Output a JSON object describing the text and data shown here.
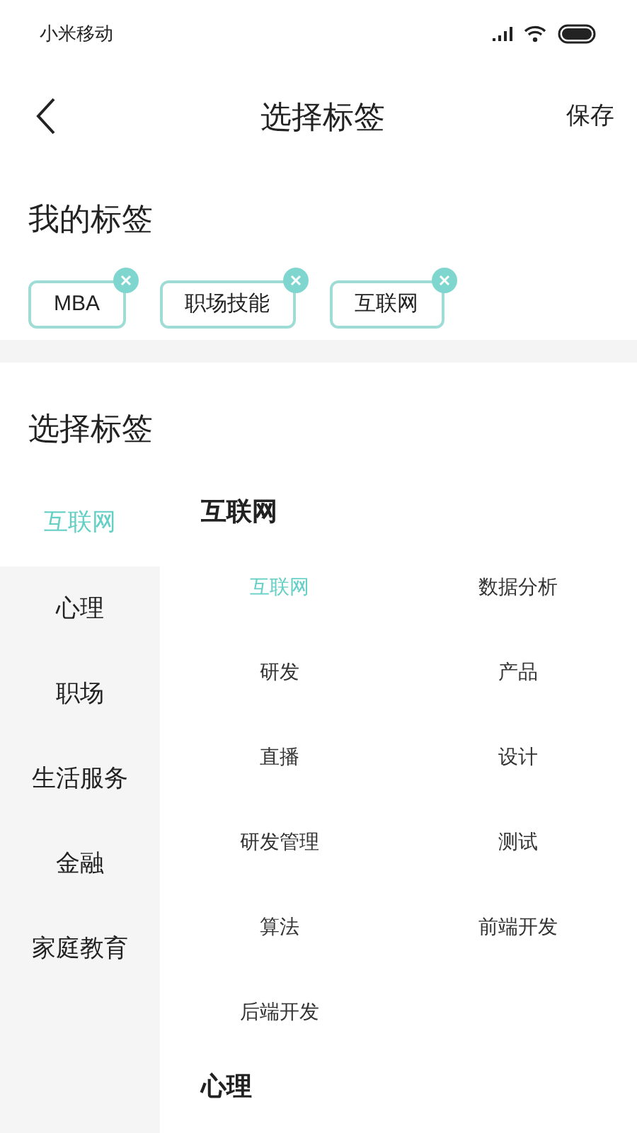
{
  "status_bar": {
    "carrier": "小米移动"
  },
  "nav": {
    "title": "选择标签",
    "action": "保存"
  },
  "my_tags": {
    "title": "我的标签",
    "tags": [
      {
        "label": "MBA"
      },
      {
        "label": "职场技能"
      },
      {
        "label": "互联网"
      }
    ]
  },
  "choose": {
    "title": "选择标签"
  },
  "sidebar": {
    "items": [
      {
        "label": "互联网",
        "selected": true
      },
      {
        "label": "心理",
        "selected": false
      },
      {
        "label": "职场",
        "selected": false
      },
      {
        "label": "生活服务",
        "selected": false
      },
      {
        "label": "金融",
        "selected": false
      },
      {
        "label": "家庭教育",
        "selected": false
      }
    ]
  },
  "groups": [
    {
      "title": "互联网",
      "items": [
        {
          "label": "互联网",
          "selected": true
        },
        {
          "label": "数据分析",
          "selected": false
        },
        {
          "label": "研发",
          "selected": false
        },
        {
          "label": "产品",
          "selected": false
        },
        {
          "label": "直播",
          "selected": false
        },
        {
          "label": "设计",
          "selected": false
        },
        {
          "label": "研发管理",
          "selected": false
        },
        {
          "label": "测试",
          "selected": false
        },
        {
          "label": "算法",
          "selected": false
        },
        {
          "label": "前端开发",
          "selected": false
        },
        {
          "label": "后端开发",
          "selected": false
        }
      ]
    },
    {
      "title": "心理"
    }
  ]
}
